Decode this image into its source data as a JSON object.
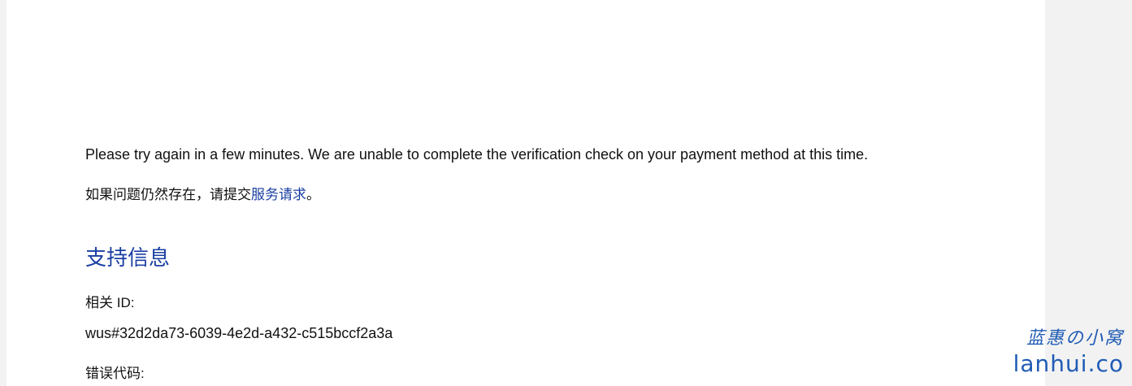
{
  "message": {
    "error_text": "Please try again in a few minutes. We are unable to complete the verification check on your payment method at this time.",
    "help_prefix": "如果问题仍然存在，请提交",
    "help_link": "服务请求",
    "help_suffix": "。"
  },
  "support": {
    "title": "支持信息",
    "correlation_label": "相关 ID:",
    "correlation_value": "wus#32d2da73-6039-4e2d-a432-c515bccf2a3a",
    "error_code_label": "错误代码:"
  },
  "watermark": {
    "cn": "蓝惠の小窝",
    "en": "lanhui.co"
  },
  "colors": {
    "link": "#1a3fa3",
    "watermark": "#1f5bb5",
    "panel": "#ffffff",
    "backdrop": "#f2f2f2"
  }
}
